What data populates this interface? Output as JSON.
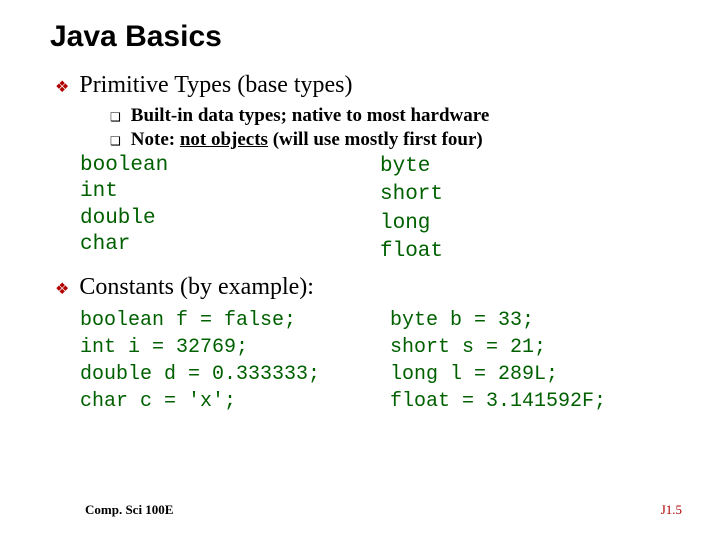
{
  "title": "Java Basics",
  "section1": {
    "heading": "Primitive Types (base types)",
    "sub1": "Built-in data types; native to most hardware",
    "sub2_a": "Note: ",
    "sub2_b": "not objects",
    "sub2_c": "  (will use mostly first four)"
  },
  "types": {
    "left": "boolean\nint\ndouble\nchar",
    "right": "byte\nshort\nlong\nfloat"
  },
  "section2": {
    "heading": "Constants (by example):"
  },
  "examples": {
    "left": "boolean f = false;\nint i = 32769;\ndouble d = 0.333333;\nchar c = 'x';",
    "right": "byte b = 33;\nshort s = 21;\nlong l = 289L;\nfloat = 3.141592F;"
  },
  "footer": {
    "left": "Comp. Sci 100E",
    "right": "J1.5"
  }
}
